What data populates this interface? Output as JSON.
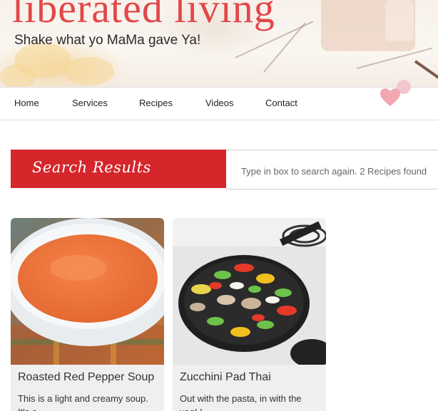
{
  "site": {
    "title": "liberated living",
    "tagline": "Shake what yo MaMa gave Ya!"
  },
  "nav": {
    "items": [
      {
        "label": "Home"
      },
      {
        "label": "Services"
      },
      {
        "label": "Recipes"
      },
      {
        "label": "Videos"
      },
      {
        "label": "Contact"
      }
    ]
  },
  "search": {
    "heading": "Search Results",
    "info": "Type in box to search again. 2 Recipes found"
  },
  "recipes": [
    {
      "title": "Roasted Red Pepper Soup",
      "description": "This is a light and creamy soup. It's a",
      "image_icon": "soup-bowl-image"
    },
    {
      "title": "Zucchini Pad Thai",
      "description": "Out with the pasta, in with the veg! I",
      "image_icon": "stir-fry-pan-image"
    }
  ],
  "colors": {
    "brand_red": "#d4262b",
    "title_red": "#e2474a",
    "card_bg": "#efefef"
  }
}
